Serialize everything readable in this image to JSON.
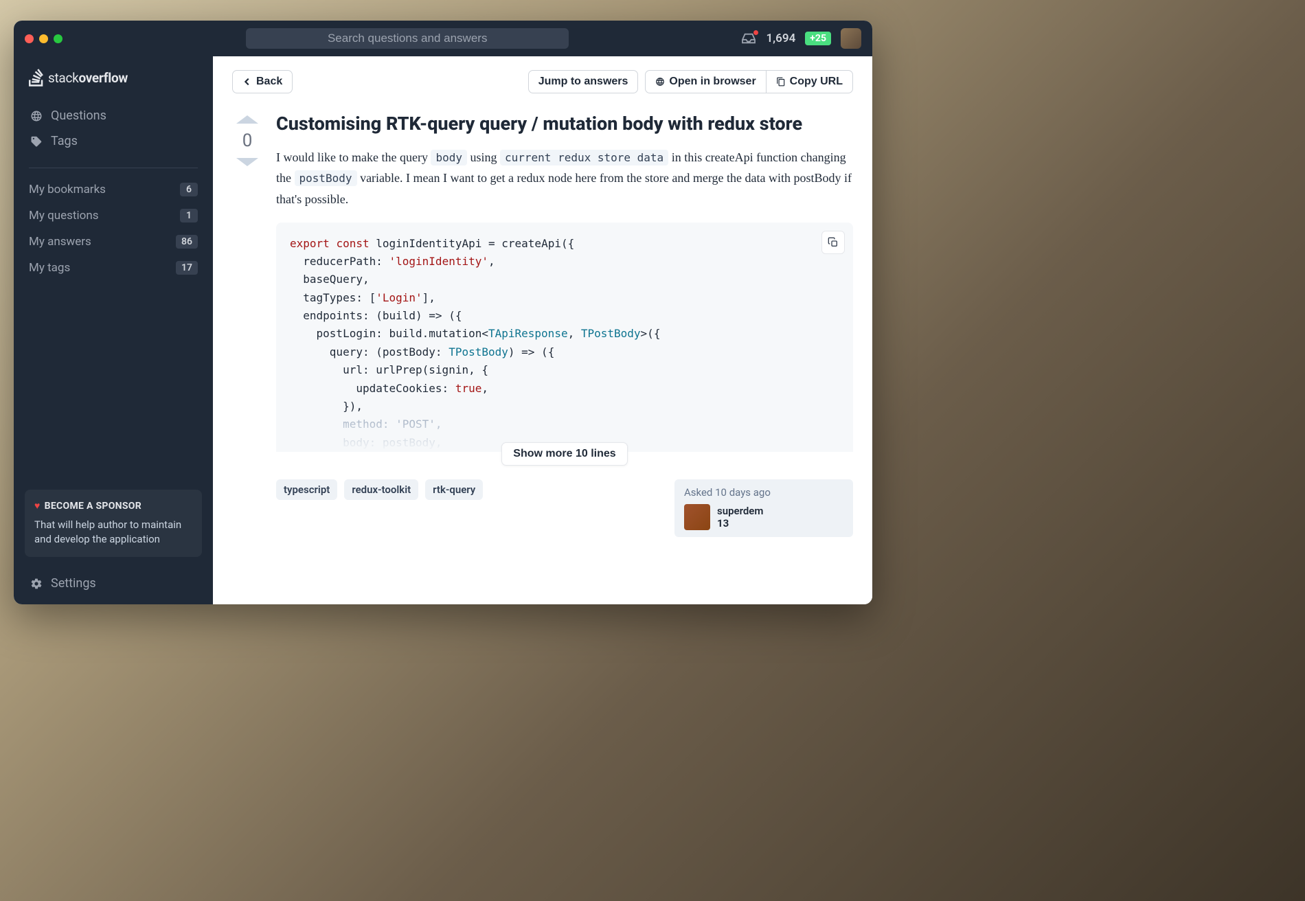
{
  "search": {
    "placeholder": "Search questions and answers"
  },
  "header": {
    "reputation": "1,694",
    "rep_delta": "+25"
  },
  "logo": {
    "prefix": "stack",
    "bold": "overflow"
  },
  "sidebar": {
    "nav": [
      {
        "label": "Questions"
      },
      {
        "label": "Tags"
      }
    ],
    "rows": [
      {
        "label": "My bookmarks",
        "count": "6"
      },
      {
        "label": "My questions",
        "count": "1"
      },
      {
        "label": "My answers",
        "count": "86"
      },
      {
        "label": "My tags",
        "count": "17"
      }
    ],
    "sponsor": {
      "title": "BECOME A SPONSOR",
      "body": "That will help author to maintain and develop the application"
    },
    "settings": "Settings"
  },
  "toolbar": {
    "back": "Back",
    "jump": "Jump to answers",
    "open": "Open in browser",
    "copy": "Copy URL"
  },
  "question": {
    "score": "0",
    "title": "Customising RTK-query query / mutation body with redux store",
    "body_parts": {
      "p1": "I would like to make the query ",
      "c1": "body",
      "p2": " using ",
      "c2": "current redux store data",
      "p3": " in this createApi function changing the ",
      "c3": "postBody",
      "p4": " variable. I mean I want to get a redux node here from the store and merge the data with postBody if that's possible."
    },
    "show_more": "Show more 10 lines",
    "tags": [
      "typescript",
      "redux-toolkit",
      "rtk-query"
    ],
    "asked": "Asked 10 days ago",
    "author": {
      "name": "superdem",
      "rep": "13"
    }
  },
  "code": {
    "l1a": "export",
    "l1b": "const",
    "l1c": " loginIdentityApi = createApi({",
    "l2a": "  reducerPath: ",
    "l2b": "'loginIdentity'",
    "l2c": ",",
    "l3": "  baseQuery,",
    "l4a": "  tagTypes: [",
    "l4b": "'Login'",
    "l4c": "],",
    "l5": "  endpoints: (build) => ({",
    "l6a": "    postLogin: build.mutation<",
    "l6b": "TApiResponse",
    "l6c": ", ",
    "l6d": "TPostBody",
    "l6e": ">({",
    "l7a": "      query: (postBody: ",
    "l7b": "TPostBody",
    "l7c": ") => ({",
    "l8": "        url: urlPrep(signin, {",
    "l9a": "          updateCookies: ",
    "l9b": "true",
    "l9c": ",",
    "l10": "        }),",
    "l11a": "        method: ",
    "l11b": "'POST'",
    "l11c": ",",
    "l12": "        body: postBody,"
  }
}
